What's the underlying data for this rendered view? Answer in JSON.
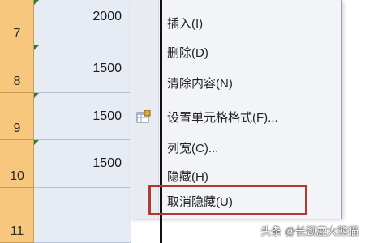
{
  "sheet": {
    "rows": [
      "7",
      "8",
      "9",
      "10",
      "11"
    ],
    "values": [
      "2000",
      "1500",
      "1500",
      "1500",
      ""
    ]
  },
  "context_menu": {
    "items": [
      {
        "label": "插入(I)"
      },
      {
        "label": "删除(D)"
      },
      {
        "label": "清除内容(N)"
      },
      {
        "label": "设置单元格格式(F)..."
      },
      {
        "label": "列宽(C)..."
      },
      {
        "label": "隐藏(H)"
      },
      {
        "label": "取消隐藏(U)"
      }
    ],
    "highlighted_item": "取消隐藏(U)",
    "icons": {
      "format_cells": "format-cells-icon"
    }
  },
  "watermark": "头条 @长颈鹿大熊猫",
  "colors": {
    "row_header_bg": "#f7c77e",
    "selected_col_bg": "#e6ebf4",
    "menu_bg": "#f2f4f8",
    "highlight_border": "#b23a33"
  }
}
